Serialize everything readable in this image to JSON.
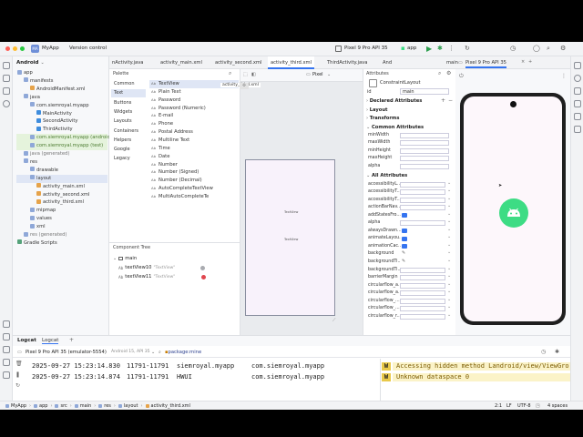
{
  "window": {
    "app_badge": "MA",
    "app_name": "MyApp",
    "vcs": "Version control",
    "device": "Pixel 9 Pro API 35",
    "run_config": "app"
  },
  "project_panel": {
    "title": "Android",
    "items": [
      {
        "label": "app",
        "indent": 0
      },
      {
        "label": "manifests",
        "indent": 1
      },
      {
        "label": "AndroidManifest.xml",
        "indent": 2
      },
      {
        "label": "java",
        "indent": 1
      },
      {
        "label": "com.siemroyal.myapp",
        "indent": 2
      },
      {
        "label": "MainActivity",
        "indent": 3
      },
      {
        "label": "SecondActivity",
        "indent": 3
      },
      {
        "label": "ThirdActivity",
        "indent": 3
      },
      {
        "label": "com.siemroyal.myapp (androidT",
        "indent": 2
      },
      {
        "label": "com.siemroyal.myapp (test)",
        "indent": 2
      },
      {
        "label": "java (generated)",
        "indent": 1
      },
      {
        "label": "res",
        "indent": 1
      },
      {
        "label": "drawable",
        "indent": 2
      },
      {
        "label": "layout",
        "indent": 2
      },
      {
        "label": "activity_main.xml",
        "indent": 3
      },
      {
        "label": "activity_second.xml",
        "indent": 3
      },
      {
        "label": "activity_third.xml",
        "indent": 3
      },
      {
        "label": "mipmap",
        "indent": 2
      },
      {
        "label": "values",
        "indent": 2
      },
      {
        "label": "xml",
        "indent": 2
      },
      {
        "label": "res (generated)",
        "indent": 1
      },
      {
        "label": "Gradle Scripts",
        "indent": 0
      }
    ]
  },
  "tabs": [
    "nActivity.java",
    "activity_main.xml",
    "activity_second.xml",
    "activity_third.xml",
    "ThirdActivity.java",
    "And"
  ],
  "emulator_tab": "Pixel 9 Pro API 35",
  "emulator_extra_tab": "main",
  "palette": {
    "title": "Palette",
    "categories": [
      "Common",
      "Text",
      "Buttons",
      "Widgets",
      "Layouts",
      "Containers",
      "Helpers",
      "Google",
      "Legacy"
    ],
    "items": [
      "TextView",
      "Plain Text",
      "Password",
      "Password (Numeric)",
      "E-mail",
      "Phone",
      "Postal Address",
      "Multiline Text",
      "Time",
      "Date",
      "Number",
      "Number (Signed)",
      "Number (Decimal)",
      "AutoCompleteTextView",
      "MultiAutoCompleteTe"
    ],
    "item_icon": "Ab"
  },
  "design_toolbar": {
    "file": "activity_third.xml",
    "device": "Pixel"
  },
  "component_tree": {
    "title": "Component Tree",
    "root": "main",
    "rows": [
      {
        "name": "textView10",
        "hint": "\"TextView\""
      },
      {
        "name": "textView11",
        "hint": "\"TextView\""
      }
    ]
  },
  "canvas": {
    "label1": "TextView",
    "label2": "TextView"
  },
  "attributes": {
    "title": "Attributes",
    "type": "ConstraintLayout",
    "id_label": "id",
    "id_value": "main",
    "sections": [
      "Declared Attributes",
      "Layout",
      "Transforms",
      "Common Attributes",
      "All Attributes"
    ],
    "common": [
      "minWidth",
      "maxWidth",
      "minHeight",
      "maxHeight",
      "alpha"
    ],
    "all": [
      "accessibilityL...",
      "accessibilityT...",
      "accessibilityT...",
      "actionBarNav...",
      "addStatesFro...",
      "alpha",
      "alwaysDrawn...",
      "animateLayou...",
      "animationCac...",
      "background",
      "backgroundTi...",
      "backgroundTi...",
      "barrierMargin",
      "circularflow_a...",
      "circularflow_a...",
      "circularflow_...",
      "circularflow_...",
      "circularflow_r..."
    ]
  },
  "logcat": {
    "tabs": [
      "Logcat",
      "Logcat"
    ],
    "device": "Pixel 9 Pro API 35 (emulator-5554)",
    "device_sub": "Android 15, API 35",
    "filter": "package:mine",
    "lines": [
      {
        "time": "2025-09-27 15:23:14.830",
        "pid": "11791-11791",
        "tag": "siemroyal.myapp",
        "pkg": "com.siemroyal.myapp",
        "level": "W",
        "msg": "Accessing hidden method Landroid/view/ViewGroup"
      },
      {
        "time": "2025-09-27 15:23:14.874",
        "pid": "11791-11791",
        "tag": "HWUI",
        "pkg": "com.siemroyal.myapp",
        "level": "W",
        "msg": "Unknown dataspace 0"
      }
    ]
  },
  "status_bar": {
    "crumbs": [
      "MyApp",
      "app",
      "src",
      "main",
      "res",
      "layout",
      "activity_third.xml"
    ],
    "position": "2:1",
    "line_ending": "LF",
    "encoding": "UTF-8",
    "indent": "4 spaces"
  },
  "colors": {
    "accent": "#3574f0",
    "android_green": "#3ddc84",
    "canvas_bg": "#f8f2fb",
    "blueprint": "#1f5a66",
    "warn_bg": "#fbf3c8"
  }
}
